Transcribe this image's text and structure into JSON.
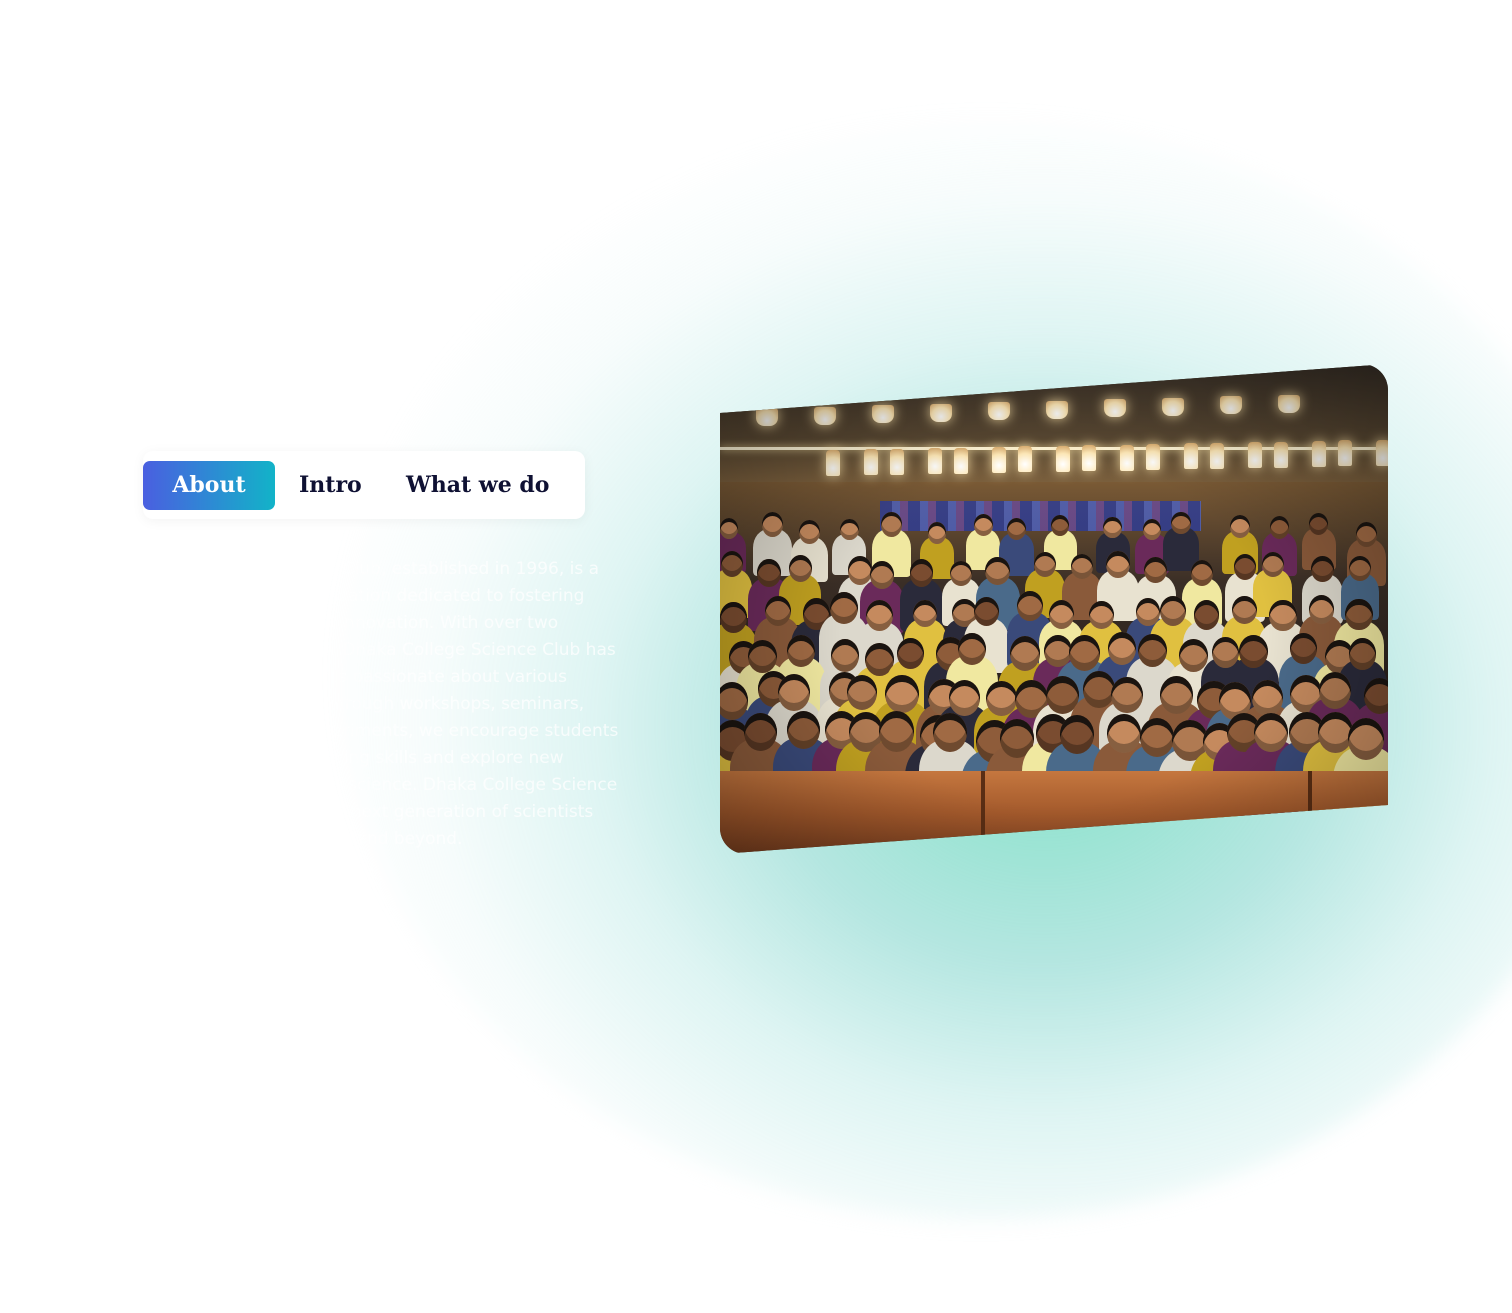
{
  "tabs": [
    {
      "label": "About",
      "active": true
    },
    {
      "label": "Intro",
      "active": false
    },
    {
      "label": "What we do",
      "active": false
    }
  ],
  "description": "Dhaka College Science Club, established in 1996, is a premier student organization dedicated to fostering scientific curiosity and innovation. With over two decades of excellence, Dhaka College Science Club has been a hub for students passionate about various scientific disciplines. Through workshops, seminars, competitions, and experiments, we encourage students to develop critical thinking skills and explore new frontiers in the world of science. Dhaka College Science Club aims to inspire the next generation of scientists and innovators in Dhaka and beyond.",
  "colors": {
    "tab_active_gradient_start": "#4a5fe0",
    "tab_active_gradient_end": "#12b3c8",
    "tab_text": "#0f1133",
    "glow": "#6edcbe"
  },
  "photo": {
    "subject": "group-photo"
  }
}
